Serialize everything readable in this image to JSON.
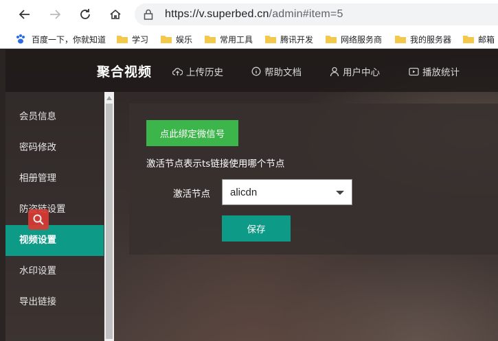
{
  "browser": {
    "url_host": "https://v.superbed.cn",
    "url_path": "/admin#item=5",
    "bookmarks": [
      {
        "label": "百度一下，你就知道",
        "icon": "paw-icon"
      },
      {
        "label": "学习",
        "icon": "folder-icon"
      },
      {
        "label": "娱乐",
        "icon": "folder-icon"
      },
      {
        "label": "常用工具",
        "icon": "folder-icon"
      },
      {
        "label": "腾讯开发",
        "icon": "folder-icon"
      },
      {
        "label": "网络服务商",
        "icon": "folder-icon"
      },
      {
        "label": "我的服务器",
        "icon": "folder-icon"
      },
      {
        "label": "邮箱",
        "icon": "folder-icon"
      }
    ]
  },
  "header": {
    "brand": "聚合视频",
    "nav": [
      {
        "label": "上传历史",
        "icon": "cloud-upload-icon"
      },
      {
        "label": "帮助文档",
        "icon": "info-circle-icon"
      },
      {
        "label": "用户中心",
        "icon": "user-icon"
      },
      {
        "label": "播放统计",
        "icon": "video-icon"
      }
    ]
  },
  "sidebar": {
    "items": [
      {
        "label": "会员信息"
      },
      {
        "label": "密码修改"
      },
      {
        "label": "相册管理"
      },
      {
        "label": "防盗链设置"
      },
      {
        "label": "视频设置"
      },
      {
        "label": "水印设置"
      },
      {
        "label": "导出链接"
      }
    ],
    "active_index": 4
  },
  "main": {
    "bind_button": "点此绑定微信号",
    "hint": "激活节点表示ts链接使用哪个节点",
    "node_label": "激活节点",
    "node_value": "alicdn",
    "save_button": "保存"
  },
  "colors": {
    "accent": "#0d9b87",
    "bind_green": "#3cb54a"
  }
}
